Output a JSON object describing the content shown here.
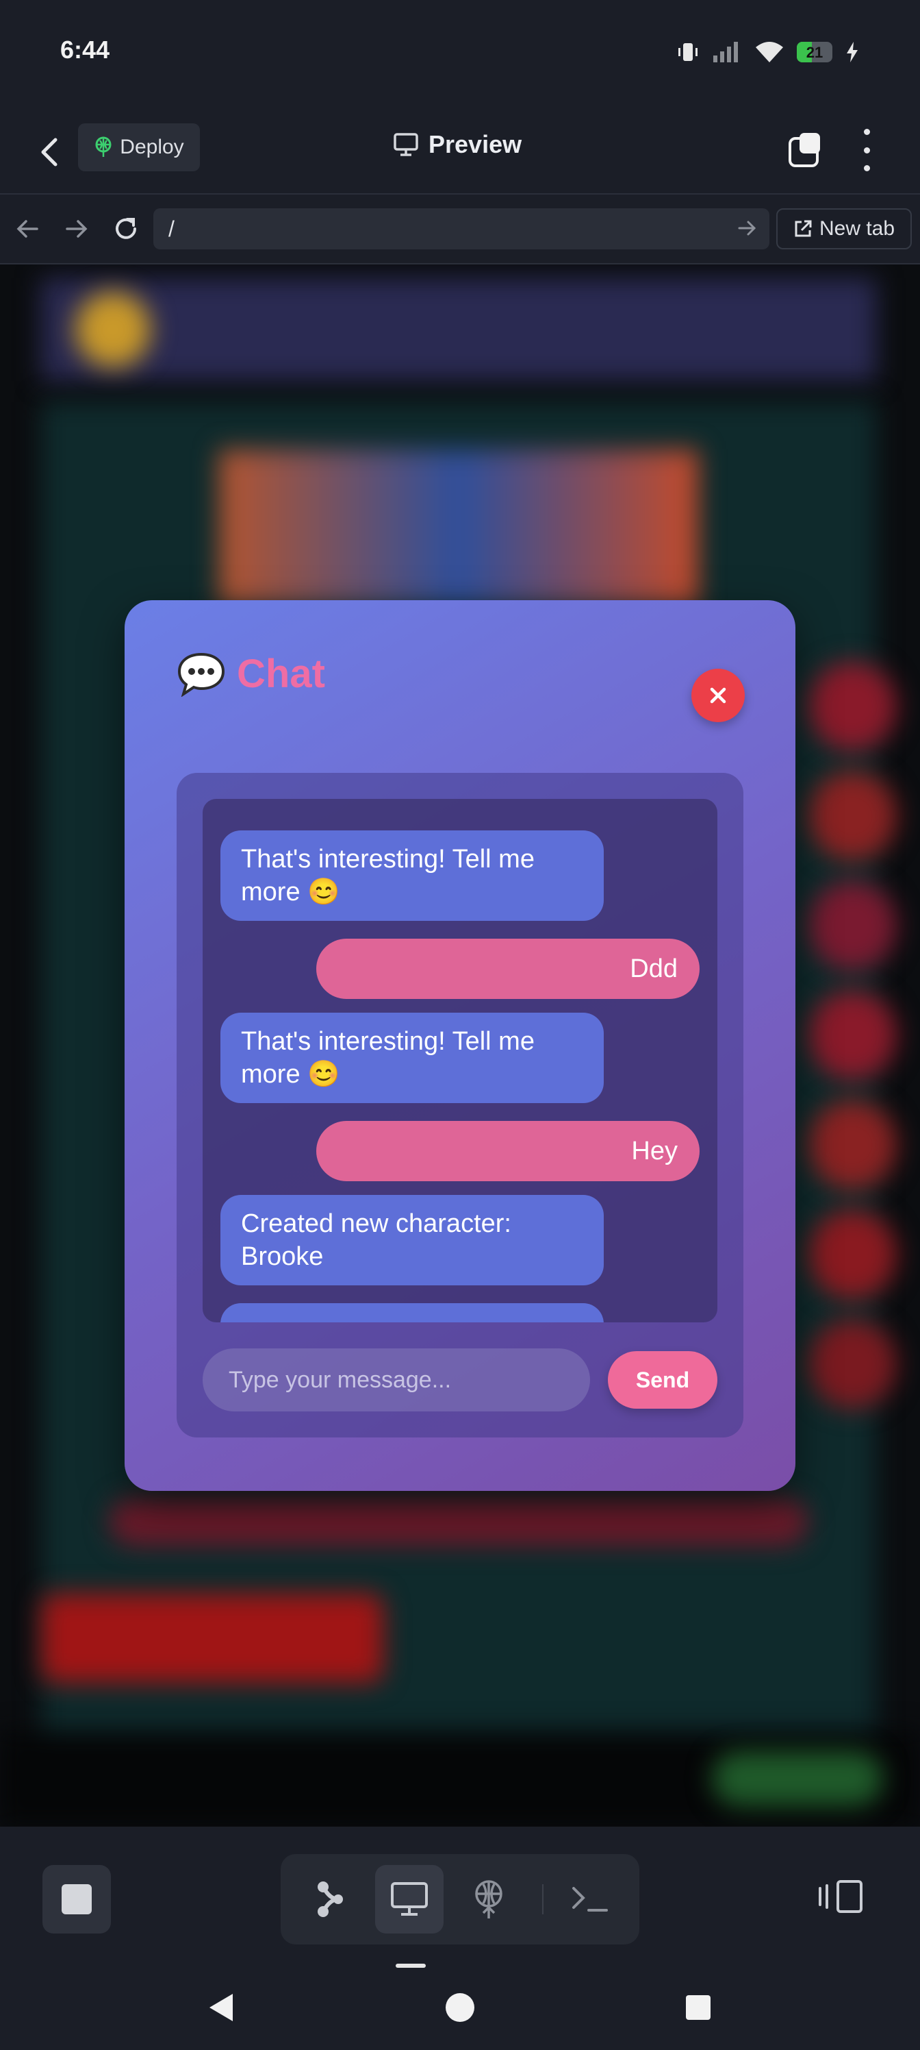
{
  "status_bar": {
    "time": "6:44",
    "battery": "21"
  },
  "header": {
    "deploy_label": "Deploy",
    "title": "Preview"
  },
  "url_bar": {
    "path": "/",
    "new_tab_label": "New tab"
  },
  "chat": {
    "title": "Chat",
    "close_symbol": "✕",
    "messages": [
      {
        "from": "bot",
        "text": "That's interesting! Tell me more 😊"
      },
      {
        "from": "user",
        "text": "Ddd"
      },
      {
        "from": "bot",
        "text": "That's interesting! Tell me more 😊"
      },
      {
        "from": "user",
        "text": "Hey"
      },
      {
        "from": "bot",
        "text": "Created new character: Brooke"
      }
    ],
    "input_placeholder": "Type your message...",
    "send_label": "Send"
  },
  "colors": {
    "accent_pink": "#ef6da4",
    "bot_bubble": "#5e6fd8",
    "user_bubble": "#df6597",
    "close_red": "#ec3f48"
  },
  "icons": {
    "back": "chevron-left-icon",
    "deploy": "globe-deploy-icon",
    "preview": "monitor-icon",
    "tabs": "tabs-icon",
    "menu": "more-vert-icon",
    "stop": "stop-square-icon",
    "agent": "agent-nodes-icon",
    "preview_tool": "monitor-icon",
    "deploy_tool": "deploy-icon",
    "terminal": "terminal-icon",
    "layout": "split-view-icon"
  }
}
